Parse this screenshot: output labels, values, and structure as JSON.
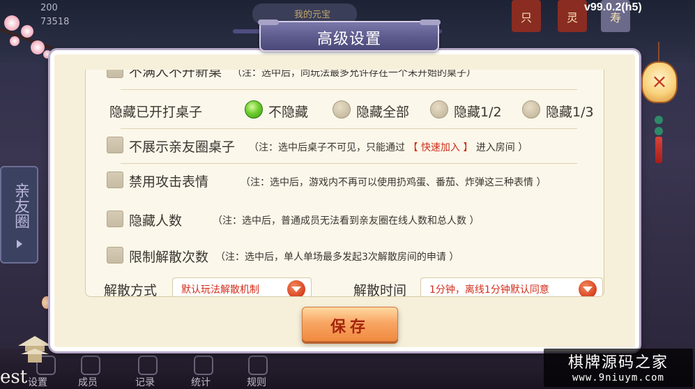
{
  "version": "v99.0.2(h5)",
  "background": {
    "stats": [
      "200",
      "73518"
    ],
    "tab_pill_label": "我的元宝",
    "corner_buttons": [
      "只",
      "灵",
      "寿"
    ],
    "side_panel_label": "亲友圈",
    "bottom_nav": [
      "设置",
      "成员",
      "记录",
      "统计",
      "规则"
    ],
    "brand_text": "est"
  },
  "dialog": {
    "title": "高级设置",
    "partial_top_row": {
      "label": "不满人不开新桌",
      "note": "（注：选中后，同玩法最多允许存在一个未开始的桌子）"
    },
    "hide_opened_tables": {
      "label": "隐藏已开打桌子",
      "options": [
        {
          "label": "不隐藏",
          "selected": true
        },
        {
          "label": "隐藏全部",
          "selected": false
        },
        {
          "label": "隐藏1/2",
          "selected": false
        },
        {
          "label": "隐藏1/3",
          "selected": false
        }
      ]
    },
    "hide_club_tables": {
      "label": "不展示亲友圈桌子",
      "note_prefix": "（注：选中后桌子不可见，只能通过",
      "note_highlight": "【 快速加入 】",
      "note_suffix": "进入房间 ）",
      "checked": false
    },
    "disable_attack_emotes": {
      "label": "禁用攻击表情",
      "note": "（注：选中后，游戏内不再可以使用扔鸡蛋、番茄、炸弹这三种表情 ）",
      "checked": false
    },
    "hide_player_count": {
      "label": "隐藏人数",
      "note": "（注：选中后，普通成员无法看到亲友圈在线人数和总人数 ）",
      "checked": false
    },
    "limit_dissolve": {
      "label": "限制解散次数",
      "note": "（注：选中后，单人单场最多发起3次解散房间的申请 ）",
      "checked": false
    },
    "dissolve_method": {
      "label": "解散方式",
      "value": "默认玩法解散机制"
    },
    "dissolve_time": {
      "label": "解散时间",
      "value": "1分钟，离线1分钟默认同意"
    },
    "save_label": "保存"
  },
  "close_label": "×",
  "watermark": {
    "line1": "棋牌源码之家",
    "line2": "www.9niuym.com"
  }
}
